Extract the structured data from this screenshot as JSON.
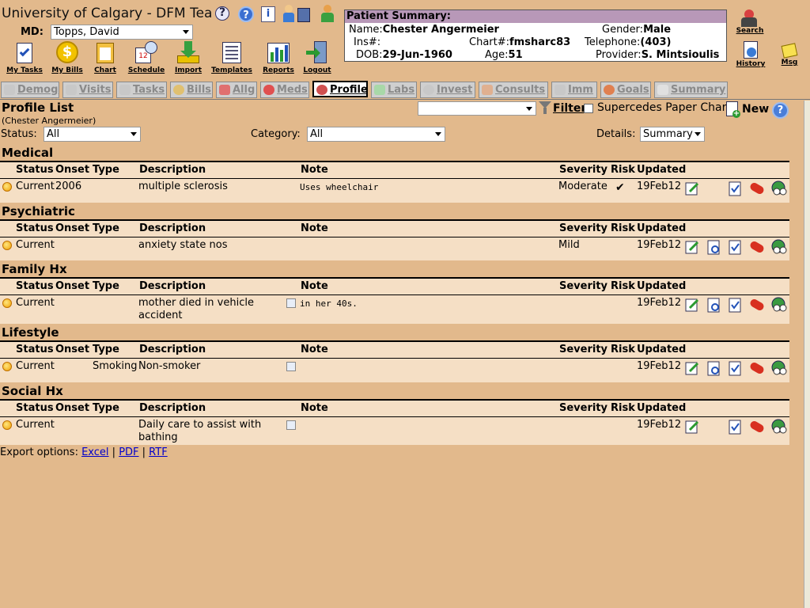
{
  "app": {
    "title": "University of Calgary - DFM Tea"
  },
  "md": {
    "label": "MD:",
    "value": "Topps, David"
  },
  "toolbar": [
    {
      "label": "My Tasks",
      "icon": "clipboard-check-icon"
    },
    {
      "label": "My Bills",
      "icon": "dollar-coin-icon"
    },
    {
      "label": "Chart",
      "icon": "chart-clipboard-icon"
    },
    {
      "label": "Schedule",
      "icon": "calendar-clock-icon"
    },
    {
      "label": "Import",
      "icon": "import-arrow-icon"
    },
    {
      "label": "Templates",
      "icon": "template-icon"
    },
    {
      "label": "Reports",
      "icon": "bar-chart-icon"
    },
    {
      "label": "Logout",
      "icon": "logout-door-icon"
    }
  ],
  "patient": {
    "title": "Patient Summary:",
    "name_label": "Name:",
    "name": "Chester Angermeier",
    "gender_label": "Gender:",
    "gender": "Male",
    "ins_label": "Ins#:",
    "ins": "",
    "chart_label": "Chart#:",
    "chart": "fmsharc83",
    "tel_label": "Telephone:",
    "tel": "(403)",
    "dob_label": "DOB:",
    "dob": "29-Jun-1960",
    "age_label": "Age:",
    "age": "51",
    "provider_label": "Provider:",
    "provider": "S. Mintsioulis"
  },
  "side_tools": {
    "search": "Search",
    "history": "History",
    "msg": "Msg"
  },
  "tabs": [
    "Demog",
    "Visits",
    "Tasks",
    "Bills",
    "Allg",
    "Meds",
    "Profile",
    "Labs",
    "Invest",
    "Consults",
    "Imm",
    "Goals",
    "Summary"
  ],
  "profile": {
    "title": "Profile List",
    "subtitle": "(Chester Angermeier)",
    "filter_label": "Filter",
    "supersede_label": "Supercedes Paper Chart",
    "new_label": "New",
    "status_label": "Status:",
    "status_value": "All",
    "category_label": "Category:",
    "category_value": "All",
    "details_label": "Details:",
    "details_value": "Summary"
  },
  "columns": {
    "status": "Status",
    "onset": "Onset",
    "type": "Type",
    "description": "Description",
    "note": "Note",
    "severity": "Severity",
    "risk": "Risk",
    "updated": "Updated"
  },
  "sections": [
    {
      "title": "Medical",
      "row": {
        "status": "Current",
        "onset": "2006",
        "type": "",
        "description": "multiple sclerosis",
        "description2": "",
        "note": "Uses wheelchair",
        "severity": "Moderate",
        "risk": "✔",
        "updated": "19Feb12"
      }
    },
    {
      "title": "Psychiatric",
      "row": {
        "status": "Current",
        "onset": "",
        "type": "",
        "description": "anxiety state nos",
        "description2": "",
        "note": "",
        "severity": "Mild",
        "risk": "",
        "updated": "19Feb12"
      }
    },
    {
      "title": "Family Hx",
      "row": {
        "status": "Current",
        "onset": "",
        "type": "",
        "description": "mother died in vehicle",
        "description2": "accident",
        "note": "in her 40s.",
        "severity": "",
        "risk": "",
        "updated": "19Feb12"
      }
    },
    {
      "title": "Lifestyle",
      "row": {
        "status": "Current",
        "onset": "",
        "type": "Smoking",
        "description": "Non-smoker",
        "description2": "",
        "note": "",
        "severity": "",
        "risk": "",
        "updated": "19Feb12"
      }
    },
    {
      "title": "Social Hx",
      "row": {
        "status": "Current",
        "onset": "",
        "type": "",
        "description": "Daily care to assist with",
        "description2": "bathing",
        "note": "",
        "severity": "",
        "risk": "",
        "updated": "19Feb12"
      }
    }
  ],
  "export": {
    "label": "Export options:",
    "excel": "Excel",
    "pdf": "PDF",
    "rtf": "RTF"
  }
}
